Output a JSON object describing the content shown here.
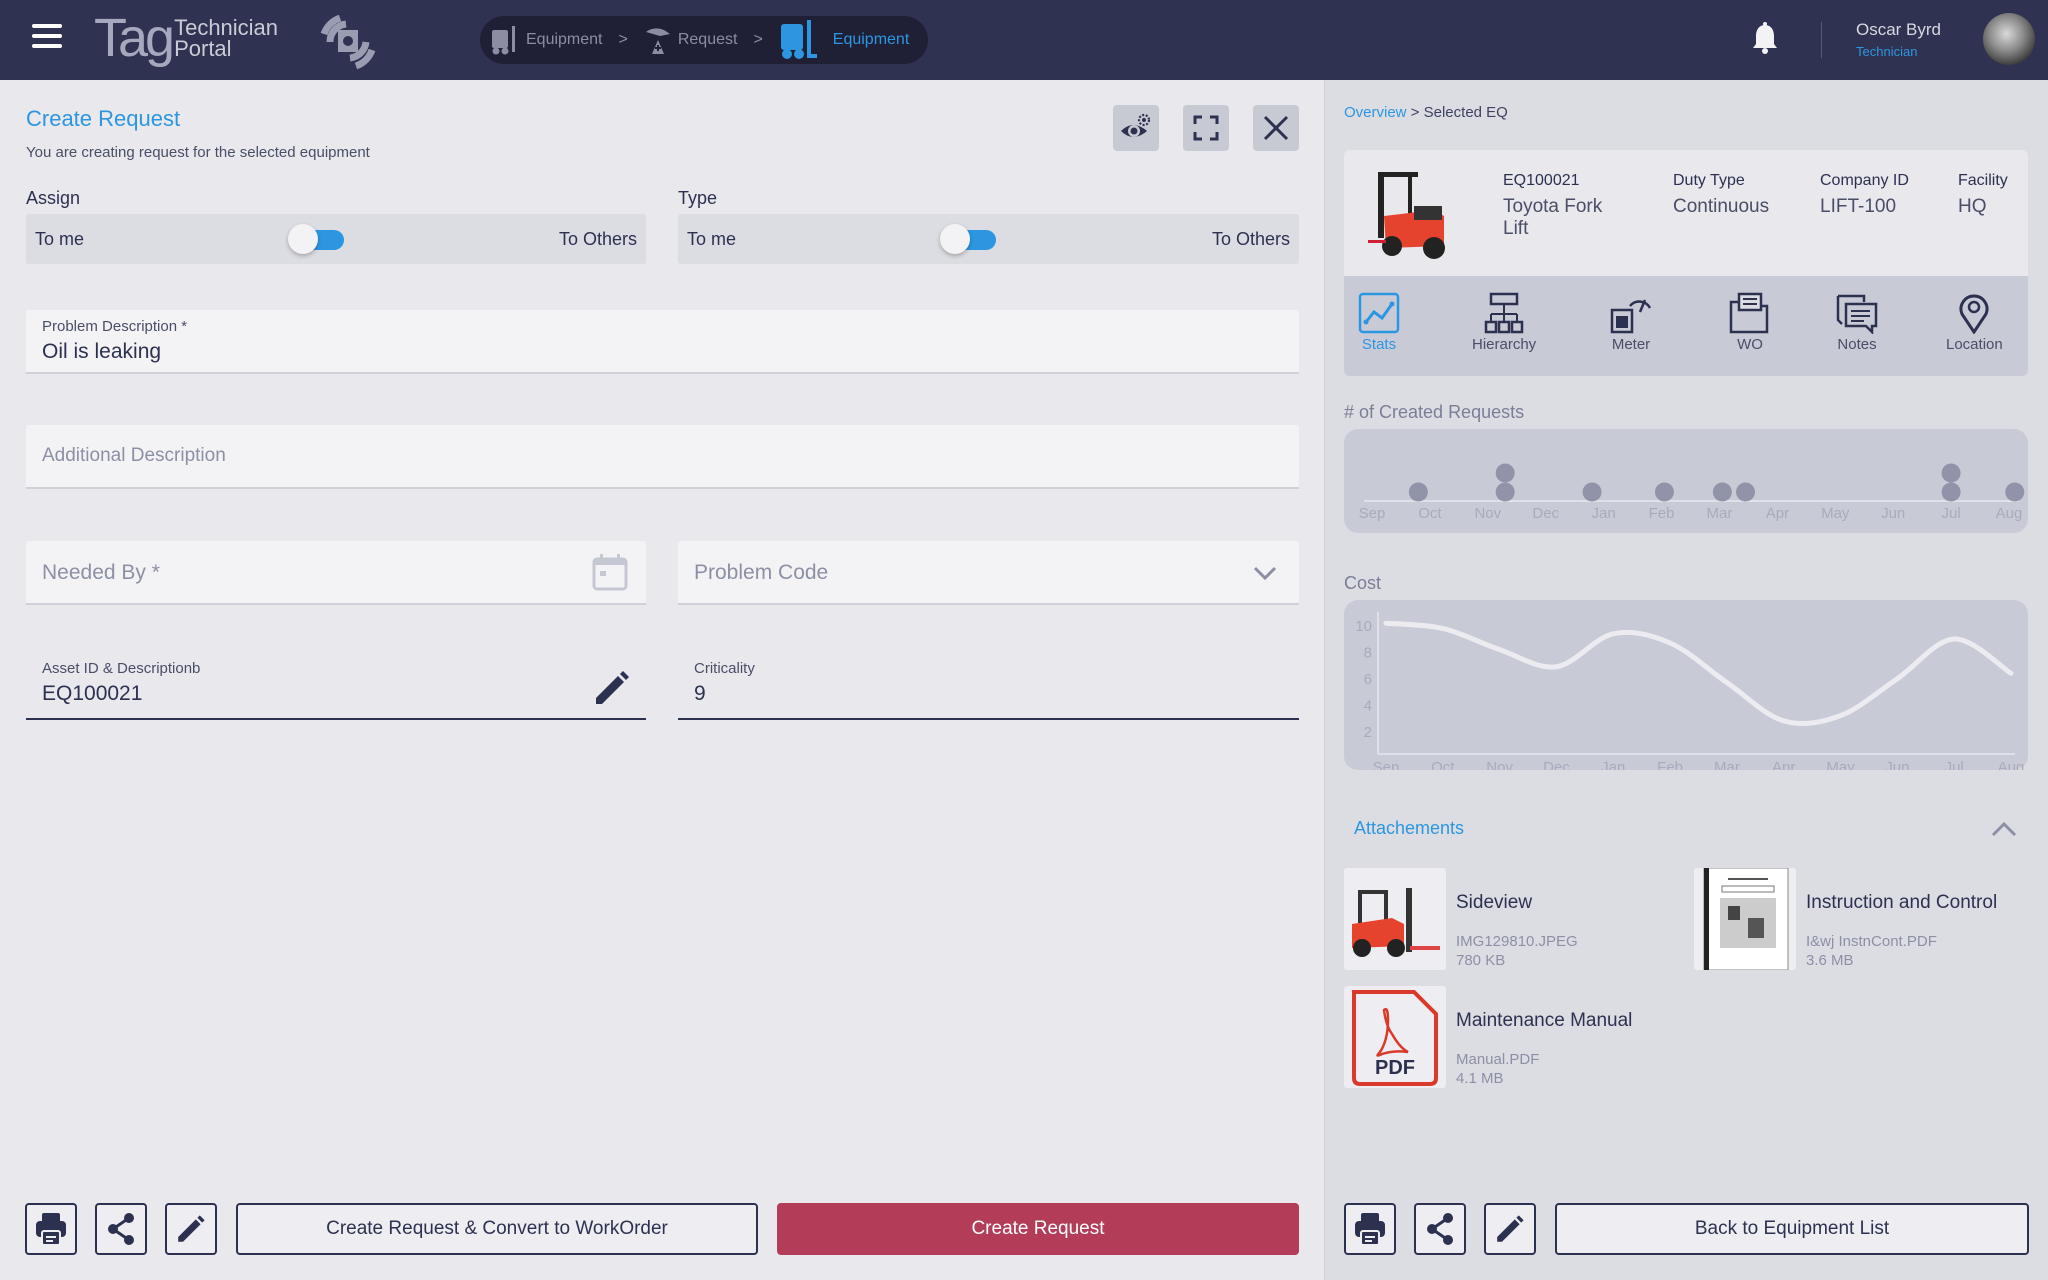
{
  "header": {
    "logo_main": "Tag",
    "logo_sub_1": "Technician",
    "logo_sub_2": "Portal",
    "breadcrumb": [
      {
        "label": "Equipment",
        "icon": "forklift-icon",
        "active": false
      },
      {
        "label": "Request",
        "icon": "request-icon",
        "active": false
      },
      {
        "label": "Equipment",
        "icon": "forklift-icon",
        "active": true
      }
    ],
    "breadcrumb_separator": ">",
    "user": {
      "name": "Oscar Byrd",
      "role": "Technician"
    }
  },
  "form": {
    "title": "Create Request",
    "subtitle": "You are creating request for the selected equipment",
    "assign": {
      "label": "Assign",
      "left": "To me",
      "right": "To Others",
      "value": "To me"
    },
    "type": {
      "label": "Type",
      "left": "To me",
      "right": "To Others",
      "value": "To me"
    },
    "problem_description": {
      "label": "Problem Description *",
      "value": "Oil is leaking"
    },
    "additional_description": {
      "placeholder": "Additional Description",
      "value": ""
    },
    "needed_by": {
      "placeholder": "Needed  By *",
      "value": ""
    },
    "problem_code": {
      "placeholder": "Problem Code",
      "value": ""
    },
    "asset": {
      "label": "Asset ID & Descriptionb",
      "value": "EQ100021"
    },
    "criticality": {
      "label": "Criticality",
      "value": "9"
    },
    "buttons": {
      "convert": "Create Request & Convert to WorkOrder",
      "create": "Create Request"
    }
  },
  "panel": {
    "breadcrumb_link": "Overview",
    "breadcrumb_sep": " > ",
    "breadcrumb_current": "Selected EQ",
    "equipment": {
      "id": "EQ100021",
      "name": "Toyota  Fork Lift",
      "duty_type_label": "Duty Type",
      "duty_type": "Continuous",
      "company_id_label": "Company ID",
      "company_id": "LIFT-100",
      "facility_label": "Facility",
      "facility": "HQ"
    },
    "tabs": [
      {
        "label": "Stats",
        "icon": "stats-icon",
        "active": true
      },
      {
        "label": "Hierarchy",
        "icon": "hierarchy-icon",
        "active": false
      },
      {
        "label": "Meter",
        "icon": "meter-icon",
        "active": false
      },
      {
        "label": "WO",
        "icon": "work-order-folder-icon",
        "active": false
      },
      {
        "label": "Notes",
        "icon": "notes-icon",
        "active": false
      },
      {
        "label": "Location",
        "icon": "location-pin-icon",
        "active": false
      }
    ],
    "requests_title": "# of Created Requests",
    "cost_title": "Cost",
    "attachments_title": "Attachements",
    "attachments": [
      {
        "name": "Sideview",
        "file": "IMG129810.JPEG",
        "size": "780 KB",
        "kind": "image"
      },
      {
        "name": "Instruction and Control",
        "file": "I&wj InstnCont.PDF",
        "size": "3.6 MB",
        "kind": "document"
      },
      {
        "name": "Maintenance Manual",
        "file": "Manual.PDF",
        "size": "4.1 MB",
        "kind": "pdf"
      }
    ],
    "pdf_badge": "PDF",
    "back_button": "Back to Equipment List"
  },
  "chart_data": [
    {
      "type": "scatter",
      "title": "# of Created Requests",
      "categories": [
        "Sep",
        "Oct",
        "Nov",
        "Dec",
        "Jan",
        "Feb",
        "Mar",
        "Apr",
        "May",
        "Jun",
        "Jul",
        "Aug"
      ],
      "points": [
        {
          "x": 0.8,
          "count": 1
        },
        {
          "x": 2.3,
          "count": 2
        },
        {
          "x": 3.8,
          "count": 1
        },
        {
          "x": 5.05,
          "count": 1
        },
        {
          "x": 6.05,
          "count": 1
        },
        {
          "x": 6.45,
          "count": 1
        },
        {
          "x": 10.0,
          "count": 2
        },
        {
          "x": 11.1,
          "count": 1
        }
      ],
      "grid": false
    },
    {
      "type": "line",
      "title": "Cost",
      "categories": [
        "Sep",
        "Oct",
        "Nov",
        "Dec",
        "Jan",
        "Feb",
        "Mar",
        "Apr",
        "May",
        "Jun",
        "Jul",
        "Aug"
      ],
      "series": [
        {
          "name": "Cost",
          "values": [
            10,
            9.6,
            8,
            6.7,
            9.2,
            8.5,
            5.5,
            2.6,
            3,
            5.8,
            8.8,
            6.2
          ]
        }
      ],
      "yticks": [
        2,
        4,
        6,
        8,
        10
      ],
      "ylim": [
        1,
        11
      ],
      "grid": false
    }
  ]
}
